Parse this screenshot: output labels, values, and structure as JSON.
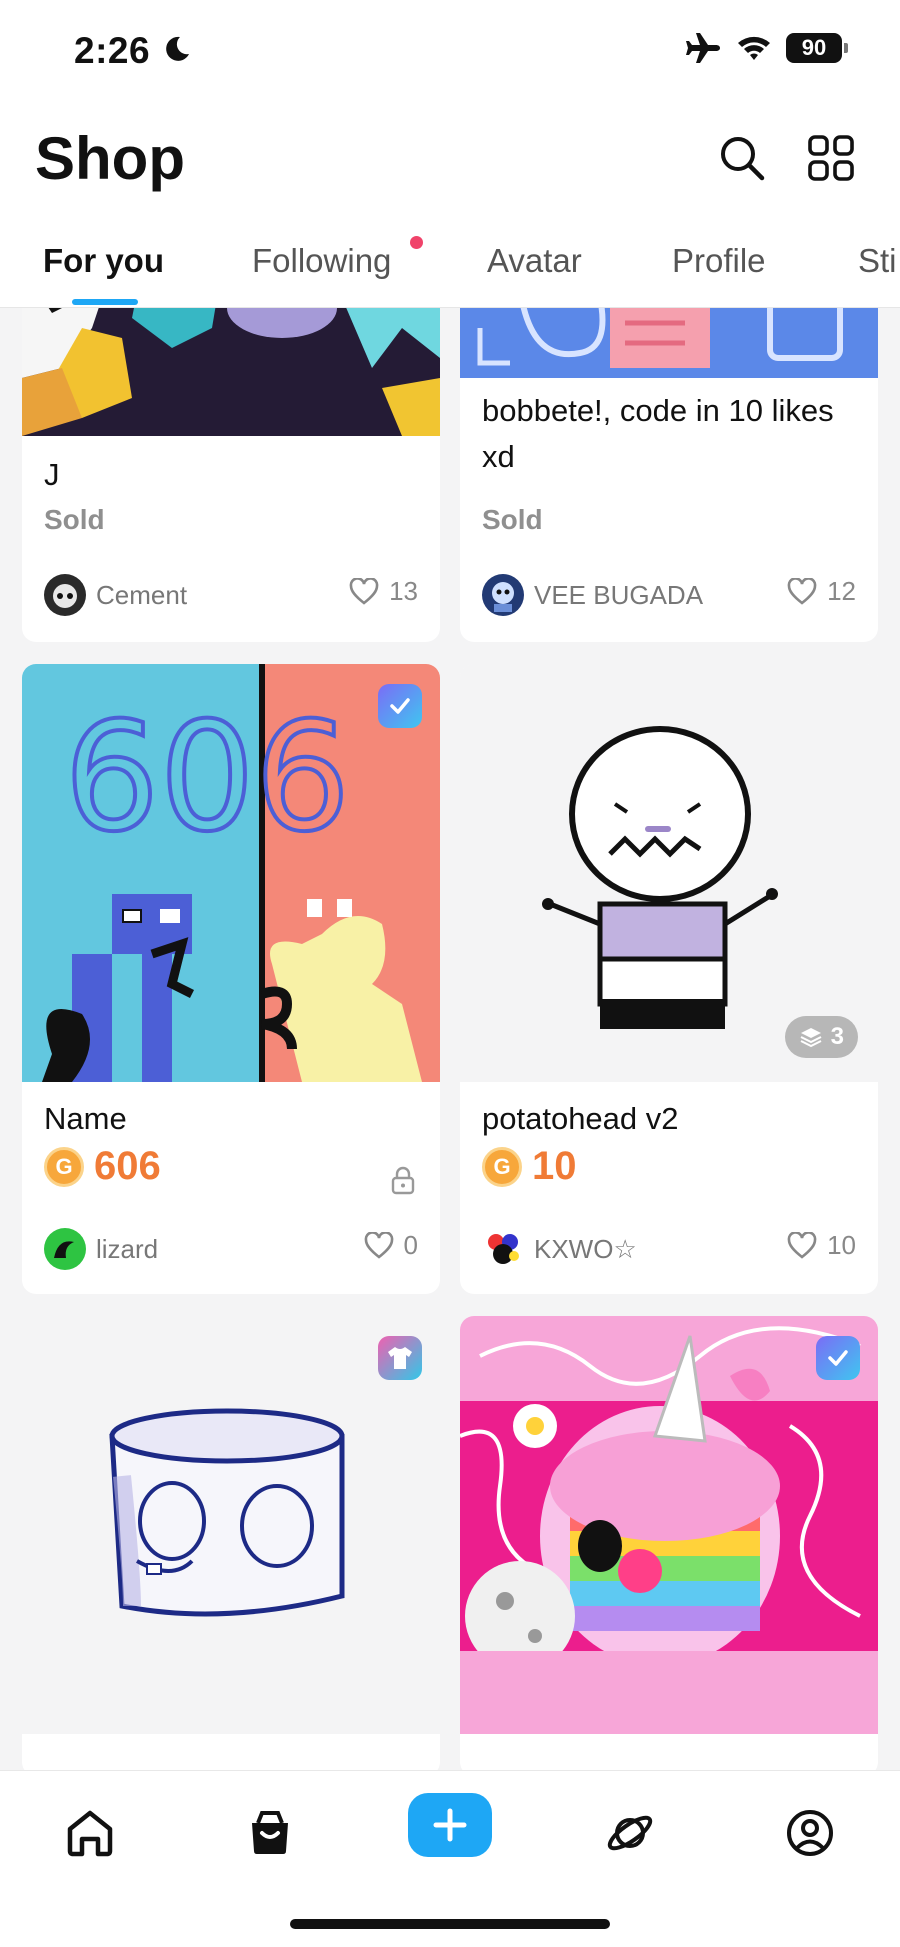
{
  "status_bar": {
    "time": "2:26",
    "battery": "90"
  },
  "header": {
    "title": "Shop"
  },
  "tabs": [
    {
      "label": "For you",
      "active": true
    },
    {
      "label": "Following",
      "notification": true
    },
    {
      "label": "Avatar"
    },
    {
      "label": "Profile"
    },
    {
      "label": "Sti"
    }
  ],
  "items": [
    {
      "title": "J",
      "status": "Sold",
      "author": "Cement",
      "likes": "13"
    },
    {
      "title": "bobbete!, code in 10 likes xd",
      "status": "Sold",
      "author": "VEE BUGADA",
      "likes": "12"
    },
    {
      "title": "Name",
      "coin_symbol": "G",
      "price": "606",
      "locked": true,
      "author": "lizard",
      "likes": "0",
      "art_text": "606",
      "badge": "verified-icon"
    },
    {
      "title": "potatohead v2",
      "coin_symbol": "G",
      "price": "10",
      "author": "KXWO☆",
      "likes": "10",
      "layers": "3"
    },
    {
      "badge": "shirt-icon"
    },
    {
      "badge": "verified-icon"
    }
  ],
  "colors": {
    "accent": "#1ea7f5",
    "price": "#f07b36",
    "notification": "#f0436a"
  }
}
